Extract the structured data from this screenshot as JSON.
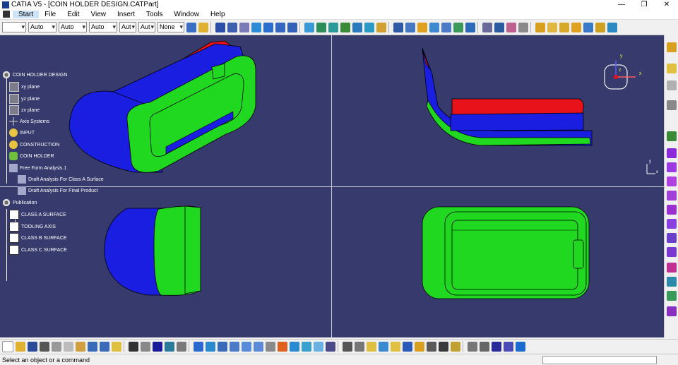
{
  "window": {
    "title": "CATIA V5 - [COIN HOLDER DESIGN.CATPart]",
    "controls": [
      "—",
      "❐",
      "✕"
    ]
  },
  "menu": [
    "Start",
    "File",
    "Edit",
    "View",
    "Insert",
    "Tools",
    "Window",
    "Help"
  ],
  "toolbar": {
    "combos": [
      "",
      "Auto",
      "Auto",
      "Auto",
      "Aut",
      "Aut",
      "None"
    ]
  },
  "compass": {
    "x": "x",
    "y": "y",
    "z": "z"
  },
  "axis_triad": {
    "x": "x",
    "y": "y"
  },
  "tree": {
    "root": "COIN HOLDER DESIGN",
    "items": [
      {
        "label": "xy plane",
        "icon": "plane-icon"
      },
      {
        "label": "yz plane",
        "icon": "plane-icon"
      },
      {
        "label": "zx plane",
        "icon": "plane-icon"
      },
      {
        "label": "Axis Systems",
        "icon": "axis-system-icon"
      },
      {
        "label": "INPUT",
        "icon": "geometrical-set-icon"
      },
      {
        "label": "CONSTRUCTION",
        "icon": "geometrical-set-icon"
      },
      {
        "label": "COIN HOLDER",
        "icon": "part-body-icon"
      },
      {
        "label": "Free Form Analysis.1",
        "icon": "analysis-icon"
      },
      {
        "label": "Draft Analysis For Class A Surface",
        "icon": "draft-analysis-icon"
      },
      {
        "label": "Draft Analysis For Final Product",
        "icon": "draft-analysis-icon"
      },
      {
        "label": "Publication",
        "icon": "publication-icon"
      },
      {
        "label": "CLASS A SURFACE",
        "icon": "publication-item-icon"
      },
      {
        "label": "TOOLING AXIS",
        "icon": "publication-item-icon"
      },
      {
        "label": "CLASS B SURFACE",
        "icon": "publication-item-icon"
      },
      {
        "label": "CLASS C SURFACE",
        "icon": "publication-item-icon"
      }
    ]
  },
  "status": {
    "message": "Select an object or a command"
  },
  "colors": {
    "viewport_bg": "#363a6c",
    "surface_blue": "#1a1ee0",
    "surface_green": "#1fd81f",
    "surface_red": "#e8121a"
  }
}
